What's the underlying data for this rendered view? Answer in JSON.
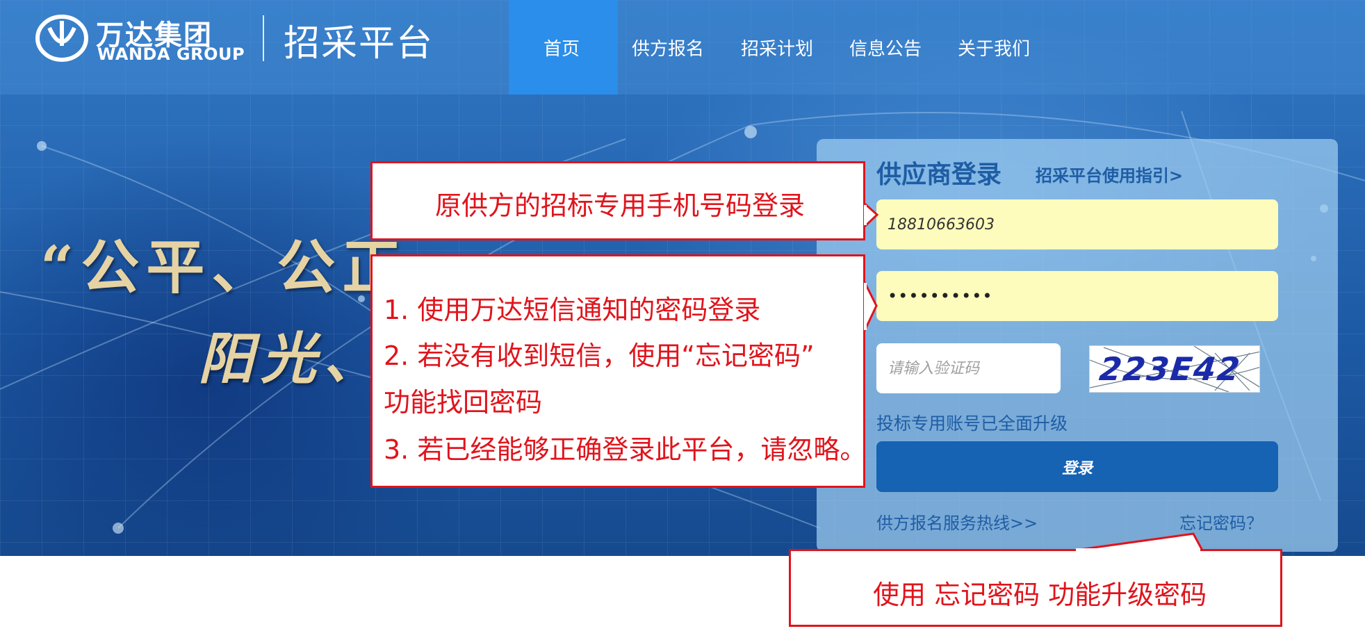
{
  "header": {
    "brand_cn": "万达集团",
    "brand_en": "WANDA GROUP",
    "platform_title": "招采平台",
    "nav": [
      "首页",
      "供方报名",
      "招采计划",
      "信息公告",
      "关于我们"
    ],
    "active_nav": "首页"
  },
  "banner": {
    "slogan_line1": "“公平、公正",
    "slogan_line2": "阳光、"
  },
  "login": {
    "title": "供应商登录",
    "guide_link": "招采平台使用指引>",
    "phone_value": "18810663603",
    "password_value": "••••••••••",
    "captcha_placeholder": "请输入验证码",
    "captcha_text": "223E42",
    "upgrade_notice": "投标专用账号已全面升级",
    "login_button": "登录",
    "hotline_link": "供方报名服务热线>>",
    "forgot_link": "忘记密码？"
  },
  "annotations": {
    "callout_phone": "原供方的招标专用手机号码登录",
    "callout_password": [
      "1. 使用万达短信通知的密码登录",
      "2. 若没有收到短信，使用“忘记密码”",
      "功能找回密码",
      "3. 若已经能够正确登录此平台，请忽略。"
    ],
    "callout_forgot": "使用 忘记密码 功能升级密码"
  },
  "colors": {
    "primary_blue": "#1662b3",
    "nav_active": "#2a8eea",
    "annotation_red": "#e0141c",
    "input_yellow": "#fdfcbc",
    "slogan_gold": "#e6d3a3"
  },
  "icons": {
    "logo": "wanda-logo-icon"
  }
}
